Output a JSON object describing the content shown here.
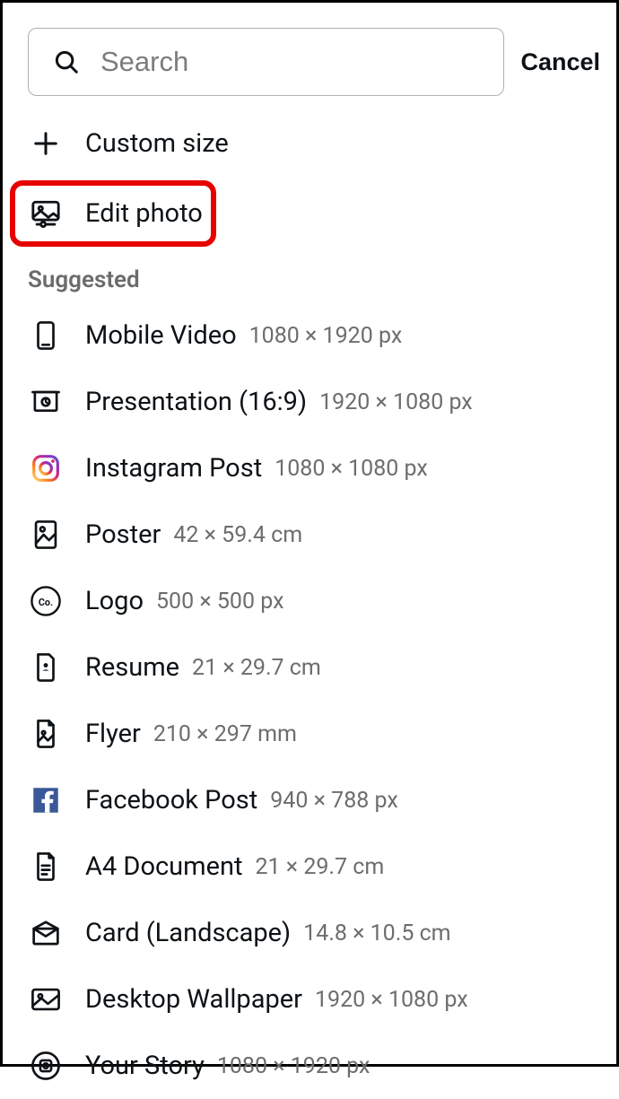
{
  "search": {
    "placeholder": "Search"
  },
  "cancel_label": "Cancel",
  "actions": {
    "custom_size": "Custom size",
    "edit_photo": "Edit photo"
  },
  "section_heading": "Suggested",
  "suggested": [
    {
      "label": "Mobile Video",
      "dims": "1080 × 1920 px"
    },
    {
      "label": "Presentation (16:9)",
      "dims": "1920 × 1080 px"
    },
    {
      "label": "Instagram Post",
      "dims": "1080 × 1080 px"
    },
    {
      "label": "Poster",
      "dims": "42 × 59.4 cm"
    },
    {
      "label": "Logo",
      "dims": "500 × 500 px"
    },
    {
      "label": "Resume",
      "dims": "21 × 29.7 cm"
    },
    {
      "label": "Flyer",
      "dims": "210 × 297 mm"
    },
    {
      "label": "Facebook Post",
      "dims": "940 × 788 px"
    },
    {
      "label": "A4 Document",
      "dims": "21 × 29.7 cm"
    },
    {
      "label": "Card (Landscape)",
      "dims": "14.8 × 10.5 cm"
    },
    {
      "label": "Desktop Wallpaper",
      "dims": "1920 × 1080 px"
    },
    {
      "label": "Your Story",
      "dims": "1080 × 1920 px"
    }
  ]
}
